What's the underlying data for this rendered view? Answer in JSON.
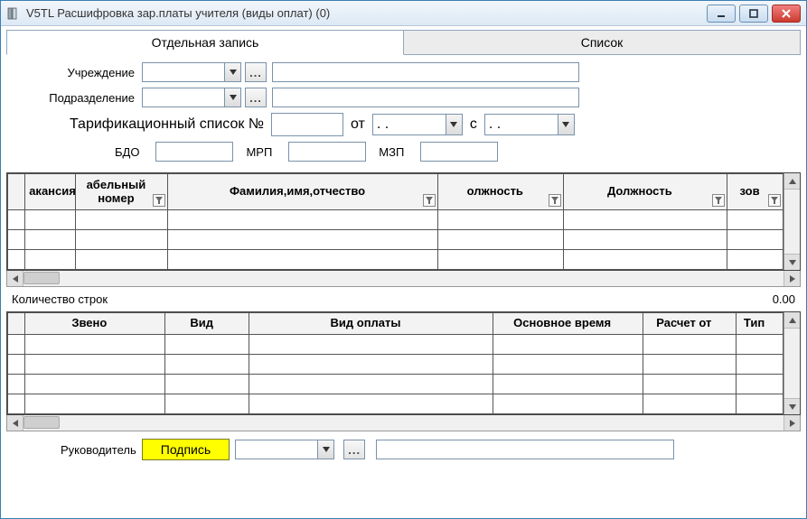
{
  "window": {
    "title": "V5TL Расшифровка зар.платы учителя (виды оплат) (0)"
  },
  "tabs": {
    "single": "Отдельная запись",
    "list": "Список"
  },
  "form": {
    "institution_label": "Учреждение",
    "department_label": "Подразделение",
    "tariff_label": "Тарификационный список №",
    "from_label": "от",
    "from_value": ". .",
    "since_label": "с",
    "since_value": ". .",
    "bdo_label": "БДО",
    "mrp_label": "МРП",
    "mzp_label": "МЗП"
  },
  "grid1": {
    "columns": {
      "vacancy": "акансия",
      "tabno_l1": "абельный",
      "tabno_l2": "номер",
      "fio": "Фамилия,имя,отчество",
      "position1": "олжность",
      "position2": "Должность",
      "zov": "зов"
    }
  },
  "rowcount": {
    "label": "Количество строк",
    "value": "0.00"
  },
  "grid2": {
    "columns": {
      "zveno": "Звено",
      "vid": "Вид",
      "vid_oplaty": "Вид оплаты",
      "osn_vremya": "Основное время",
      "raschet_ot": "Расчет от",
      "tip": "Тип"
    }
  },
  "signer": {
    "label": "Руководитель",
    "sign_button": "Подпись"
  }
}
